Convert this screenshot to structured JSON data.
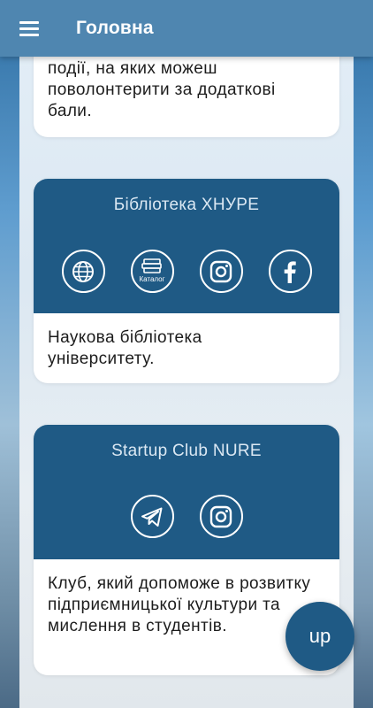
{
  "appbar": {
    "title": "Головна",
    "menu_icon": "hamburger-menu-icon"
  },
  "cards": [
    {
      "description": "події, на яких можеш поволонтерити за додаткові бали."
    },
    {
      "title": "Бібліотека ХНУРЕ",
      "icons": [
        "globe-icon",
        "catalog-books-icon",
        "instagram-icon",
        "facebook-icon"
      ],
      "catalog_label": "Каталог",
      "description": "Наукова бібліотека університету."
    },
    {
      "title": "Startup Club NURE",
      "icons": [
        "telegram-icon",
        "instagram-icon"
      ],
      "description": "Клуб, який допоможе в розвитку підприємницької культури та мислення в студентів."
    }
  ],
  "fab": {
    "label": "up"
  },
  "colors": {
    "appbar": "#4f86b0",
    "card_header": "#1f5a85",
    "fab": "#1f5a85"
  }
}
